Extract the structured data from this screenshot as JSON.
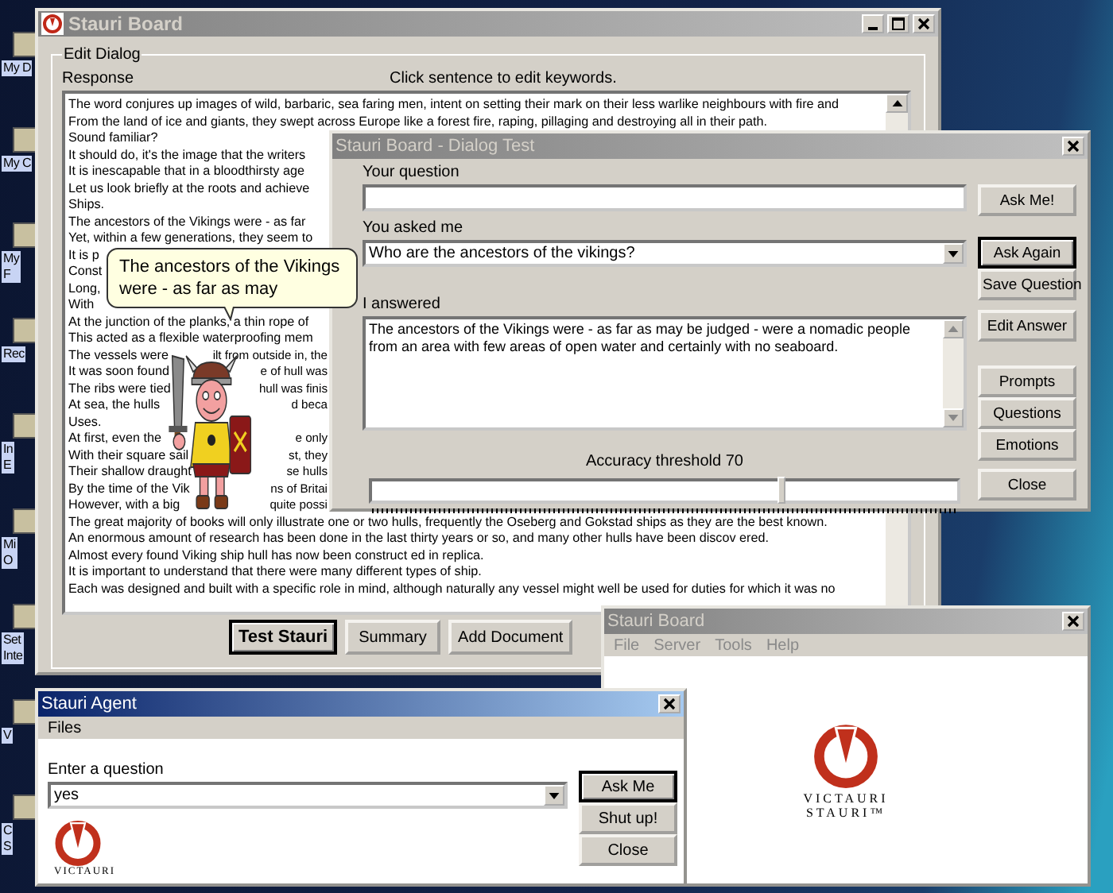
{
  "desktop_icons": [
    {
      "lines": [
        "My D"
      ]
    },
    {
      "lines": [
        "My C"
      ]
    },
    {
      "lines": [
        "My",
        "F"
      ]
    },
    {
      "lines": [
        "Rec"
      ]
    },
    {
      "lines": [
        "In",
        "E"
      ]
    },
    {
      "lines": [
        "Mi",
        "O"
      ]
    },
    {
      "lines": [
        "Set",
        "Inte"
      ]
    },
    {
      "lines": [
        "V"
      ]
    },
    {
      "lines": [
        "C",
        "S"
      ]
    }
  ],
  "main_window": {
    "title": "Stauri Board",
    "active": false,
    "group_title": "Edit Dialog",
    "response_label": "Response",
    "hint": "Click sentence to edit keywords.",
    "lines": [
      {
        "text": "The word conjures up images of wild, barbaric, sea faring men, intent on setting their mark on their less warlike neighbours with fire and"
      },
      {
        "text": "From the land of ice and giants, they swept across Europe like a forest fire, raping, pillaging and destroying all in their path."
      },
      {
        "text": "Sound familiar?"
      },
      {
        "text": "It should do, it's the image that the writers"
      },
      {
        "text": "It is inescapable that in a bloodthirsty age"
      },
      {
        "text": "Let us look briefly at the roots and achieve"
      },
      {
        "text": "Ships."
      },
      {
        "text": "The ancestors of the Vikings were - as far"
      },
      {
        "text": "Yet, within a few generations, they seem to"
      },
      {
        "text": "It is p"
      },
      {
        "text": "Const"
      },
      {
        "text": "Long,"
      },
      {
        "text": "With"
      },
      {
        "text": "At the junction of the planks, a thin rope of"
      },
      {
        "text": "This acted as a flexible waterproofing mem"
      },
      {
        "text": "The vessels were",
        "after": "ilt from outside in, the"
      },
      {
        "text": "It was soon found",
        "after": "e of hull was"
      },
      {
        "text": "The ribs were tied",
        "after": "hull was finis"
      },
      {
        "text": "At sea, the hulls",
        "after": "d beca"
      },
      {
        "text": "Uses."
      },
      {
        "text": "At first, even the",
        "after": "e only"
      },
      {
        "text": "With their square sail",
        "after": "st, they"
      },
      {
        "text": "Their shallow draught",
        "after": "se hulls"
      },
      {
        "text": "By the time of the Vik",
        "after": "ns of Britai"
      },
      {
        "text": "However, with a big",
        "after": "quite possi"
      },
      {
        "text": "The great majority of books will only illustrate one or two hulls, frequently the Oseberg and Gokstad ships as they are the best known."
      },
      {
        "text": "An enormous amount of research has been done in the last thirty years or so, and many other hulls have been discov ered."
      },
      {
        "text": "Almost every found Viking ship hull has now been construct ed in replica."
      },
      {
        "text": "It is important to understand that there were many different types of ship."
      },
      {
        "text": "Each was designed and built with a specific role in mind, although naturally any vessel might well be used for duties for which it was no"
      }
    ],
    "buttons": [
      {
        "label": "Test Stauri",
        "default": true
      },
      {
        "label": "Summary",
        "default": false
      },
      {
        "label": "Add Document",
        "default": false
      }
    ]
  },
  "dialog_test": {
    "title": "Stauri Board - Dialog Test",
    "active": false,
    "question_label": "Your question",
    "asked_label": "You asked me",
    "asked_value": "Who are the ancestors of the vikings?",
    "answer_label": "I answered",
    "answer_value": "The ancestors of the Vikings were - as far as may be judged - were a nomadic people from an area with few areas of open water and certainly with no seaboard.",
    "threshold_label": "Accuracy threshold  70",
    "threshold": {
      "level": 0.7
    },
    "button_groups": [
      [
        {
          "label": "Ask Me!",
          "default": false
        }
      ],
      [
        {
          "label": "Ask Again",
          "default": true
        },
        {
          "label": "Save Question",
          "default": false
        }
      ],
      [
        {
          "label": "Edit Answer",
          "default": false
        }
      ],
      [
        {
          "label": "Prompts",
          "default": false
        },
        {
          "label": "Questions",
          "default": false
        },
        {
          "label": "Emotions",
          "default": false
        }
      ],
      [
        {
          "label": "Close",
          "default": false
        }
      ]
    ]
  },
  "bubble": {
    "text": "The ancestors of the Vikings were - as far as may"
  },
  "board_window": {
    "title": "Stauri Board",
    "active": false,
    "menu": [
      {
        "label": "File",
        "disabled": true
      },
      {
        "label": "Server",
        "disabled": true
      },
      {
        "label": "Tools",
        "disabled": true
      },
      {
        "label": "Help",
        "disabled": true
      }
    ],
    "logo_lines": [
      "VICTAURI",
      "STAURI™"
    ]
  },
  "agent_window": {
    "title": "Stauri Agent",
    "active": true,
    "menu": [
      {
        "label": "Files",
        "disabled": false
      }
    ],
    "prompt_label": "Enter a question",
    "question_value": "yes",
    "buttons": [
      {
        "label": "Ask Me",
        "default": true
      },
      {
        "label": "Shut up!",
        "default": false
      },
      {
        "label": "Close",
        "default": false
      }
    ],
    "logo_text": "VICTAURI"
  }
}
